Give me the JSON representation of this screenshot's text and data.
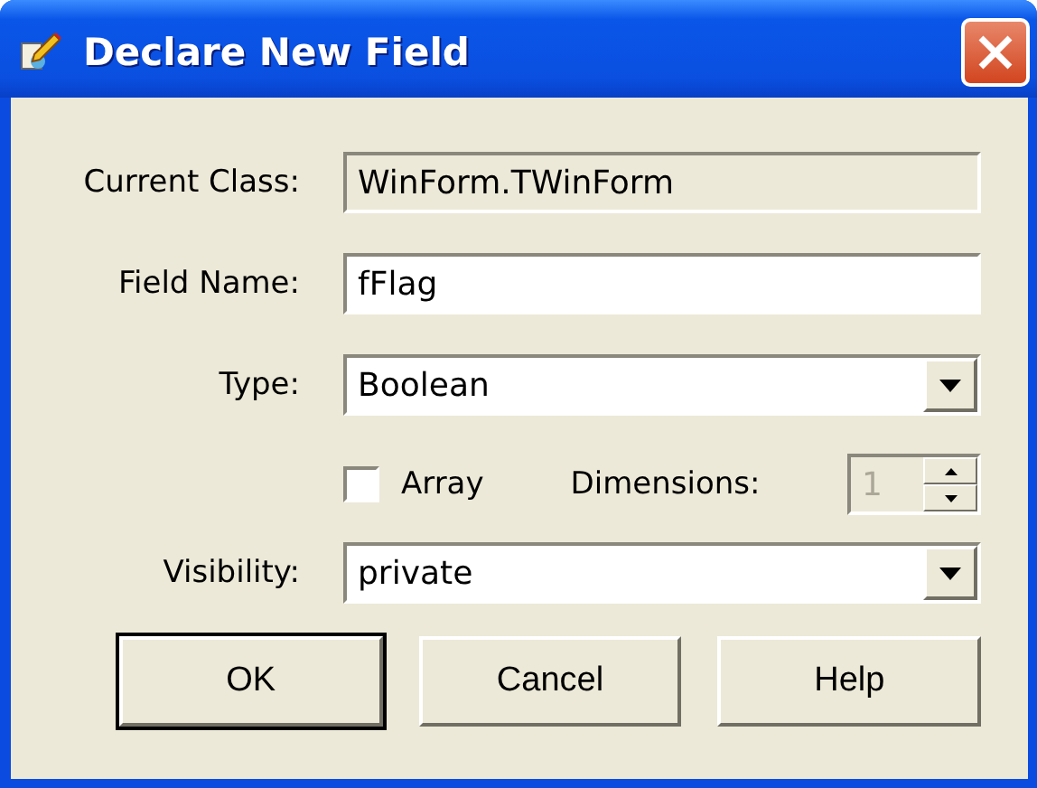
{
  "window": {
    "title": "Declare New Field"
  },
  "fields": [
    {
      "kind": "readonly",
      "label": "Current Class:",
      "value": "WinForm.TWinForm"
    },
    {
      "kind": "text",
      "label": "Field Name:",
      "value": "fFlag"
    },
    {
      "kind": "combo",
      "label": "Type:",
      "value": "Boolean"
    }
  ],
  "array": {
    "label": "Array",
    "checked": false
  },
  "dimensions": {
    "label": "Dimensions:",
    "value": "1",
    "disabled": true
  },
  "visibility": {
    "kind": "combo",
    "label": "Visibility:",
    "value": "private"
  },
  "buttons": [
    {
      "label": "OK",
      "default": true
    },
    {
      "label": "Cancel",
      "default": false
    },
    {
      "label": "Help",
      "default": false
    }
  ]
}
